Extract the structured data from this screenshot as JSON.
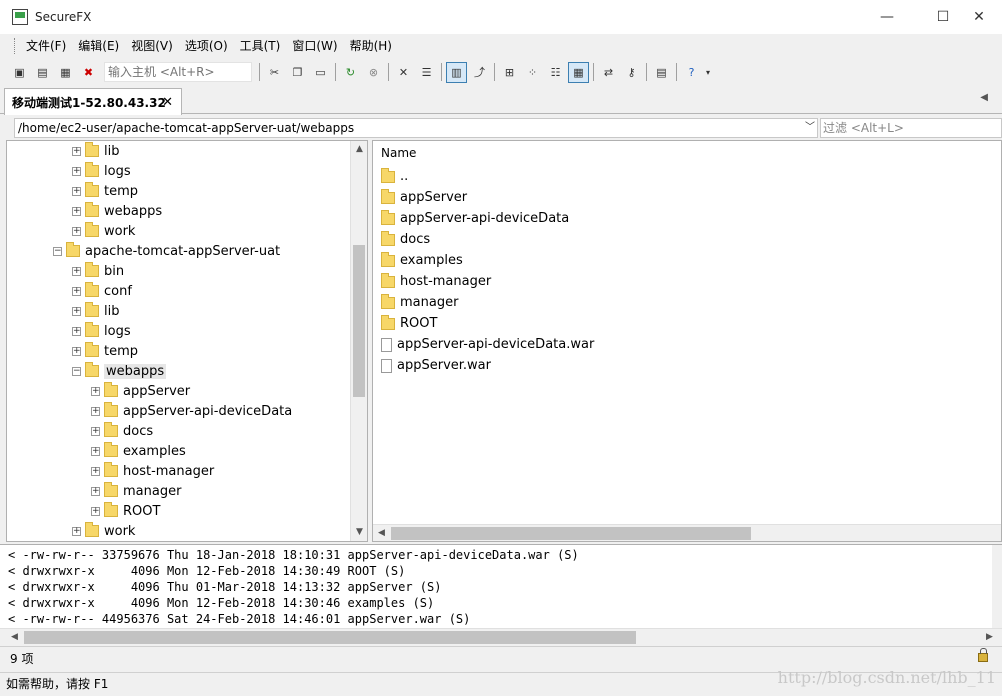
{
  "window": {
    "title": "SecureFX",
    "minimize": "—",
    "maximize": "☐",
    "close": "✕"
  },
  "menu": [
    "文件(F)",
    "编辑(E)",
    "视图(V)",
    "选项(O)",
    "工具(T)",
    "窗口(W)",
    "帮助(H)"
  ],
  "toolbar": {
    "host_placeholder": "输入主机 <Alt+R>"
  },
  "tab": {
    "label": "移动端测试1-52.80.43.32",
    "close": "✕"
  },
  "path": {
    "value": "/home/ec2-user/apache-tomcat-appServer-uat/webapps",
    "filter_placeholder": "过滤 <Alt+L>"
  },
  "tree": [
    {
      "label": "lib",
      "level": 2,
      "expander": "+"
    },
    {
      "label": "logs",
      "level": 2,
      "expander": "+"
    },
    {
      "label": "temp",
      "level": 2,
      "expander": "+"
    },
    {
      "label": "webapps",
      "level": 2,
      "expander": "+"
    },
    {
      "label": "work",
      "level": 2,
      "expander": "+"
    },
    {
      "label": "apache-tomcat-appServer-uat",
      "level": 1,
      "expander": "−"
    },
    {
      "label": "bin",
      "level": 2,
      "expander": "+"
    },
    {
      "label": "conf",
      "level": 2,
      "expander": "+"
    },
    {
      "label": "lib",
      "level": 2,
      "expander": "+"
    },
    {
      "label": "logs",
      "level": 2,
      "expander": "+"
    },
    {
      "label": "temp",
      "level": 2,
      "expander": "+"
    },
    {
      "label": "webapps",
      "level": 2,
      "expander": "−",
      "selected": true
    },
    {
      "label": "appServer",
      "level": 3,
      "expander": "+"
    },
    {
      "label": "appServer-api-deviceData",
      "level": 3,
      "expander": "+"
    },
    {
      "label": "docs",
      "level": 3,
      "expander": "+"
    },
    {
      "label": "examples",
      "level": 3,
      "expander": "+"
    },
    {
      "label": "host-manager",
      "level": 3,
      "expander": "+"
    },
    {
      "label": "manager",
      "level": 3,
      "expander": "+"
    },
    {
      "label": "ROOT",
      "level": 3,
      "expander": "+"
    },
    {
      "label": "work",
      "level": 2,
      "expander": "+"
    }
  ],
  "filelist": {
    "header": "Name",
    "items": [
      {
        "name": "..",
        "kind": "folder"
      },
      {
        "name": "appServer",
        "kind": "folder"
      },
      {
        "name": "appServer-api-deviceData",
        "kind": "folder"
      },
      {
        "name": "docs",
        "kind": "folder"
      },
      {
        "name": "examples",
        "kind": "folder"
      },
      {
        "name": "host-manager",
        "kind": "folder"
      },
      {
        "name": "manager",
        "kind": "folder"
      },
      {
        "name": "ROOT",
        "kind": "folder"
      },
      {
        "name": "appServer-api-deviceData.war",
        "kind": "file"
      },
      {
        "name": "appServer.war",
        "kind": "file"
      }
    ]
  },
  "log": [
    "< -rw-rw-r-- 33759676 Thu 18-Jan-2018 18:10:31 appServer-api-deviceData.war (S)",
    "< drwxrwxr-x     4096 Mon 12-Feb-2018 14:30:49 ROOT (S)",
    "< drwxrwxr-x     4096 Thu 01-Mar-2018 14:13:32 appServer (S)",
    "< drwxrwxr-x     4096 Mon 12-Feb-2018 14:30:46 examples (S)",
    "< -rw-rw-r-- 44956376 Sat 24-Feb-2018 14:46:01 appServer.war (S)"
  ],
  "status": {
    "count": "9 项",
    "help": "如需帮助，请按 F1"
  },
  "watermark": "http://blog.csdn.net/lhb_11"
}
